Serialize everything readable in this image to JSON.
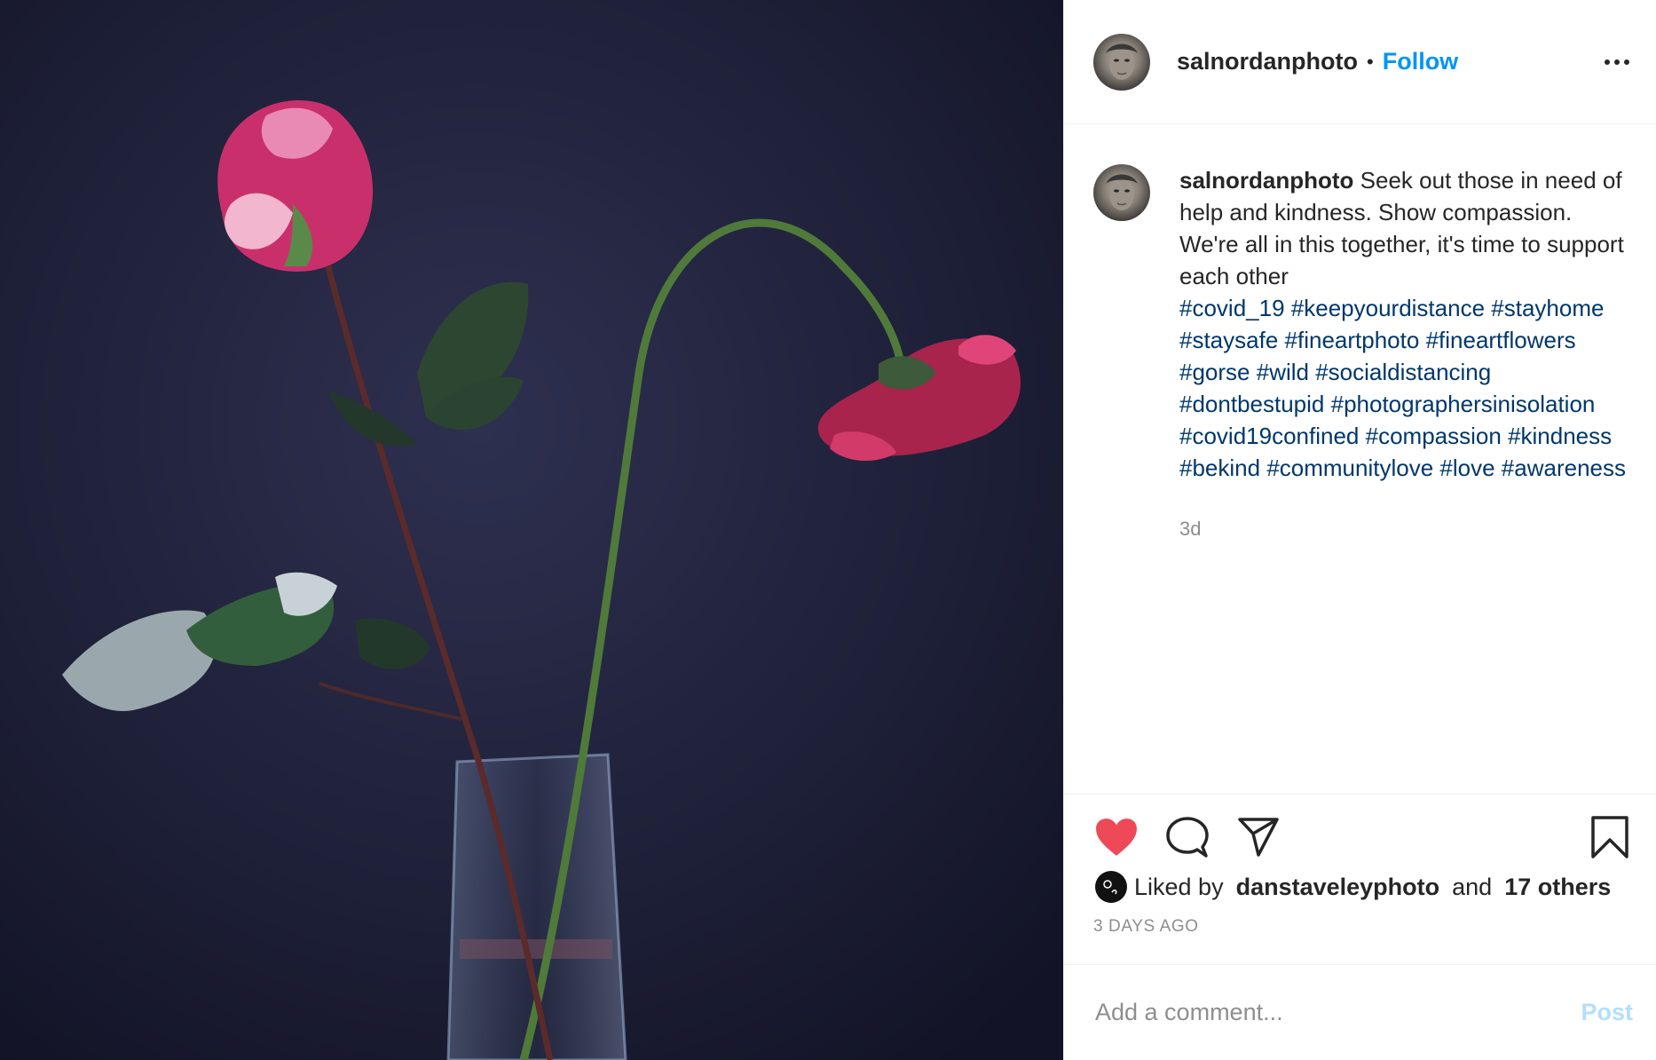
{
  "post": {
    "username": "salnordanphoto",
    "follow_label": "Follow",
    "separator": "•",
    "caption": {
      "username": "salnordanphoto",
      "text": "Seek out those in need of help and kindness. Show compassion. We're all in this together, it's time to support each other",
      "hashtags": [
        "#covid_19",
        "#keepyourdistance",
        "#stayhome",
        "#staysafe",
        "#fineartphoto",
        "#fineartflowers",
        "#gorse",
        "#wild",
        "#socialdistancing",
        "#dontbestupid",
        "#photographersinisolation",
        "#covid19confined",
        "#compassion",
        "#kindness",
        "#bekind",
        "#communitylove",
        "#love",
        "#awareness"
      ],
      "age": "3d"
    },
    "likes": {
      "prefix": "Liked by",
      "liker": "danstaveleyphoto",
      "conjunction": "and",
      "others": "17 others"
    },
    "date": "3 DAYS AGO",
    "comment": {
      "placeholder": "Add a comment...",
      "post_label": "Post"
    },
    "icons": [
      "heart-icon",
      "comment-icon",
      "share-icon",
      "bookmark-icon",
      "more-icon"
    ],
    "colors": {
      "like_red": "#ed4956",
      "follow_blue": "#0095f6",
      "hashtag": "#00376b",
      "post_disabled": "#b2dffc"
    }
  }
}
